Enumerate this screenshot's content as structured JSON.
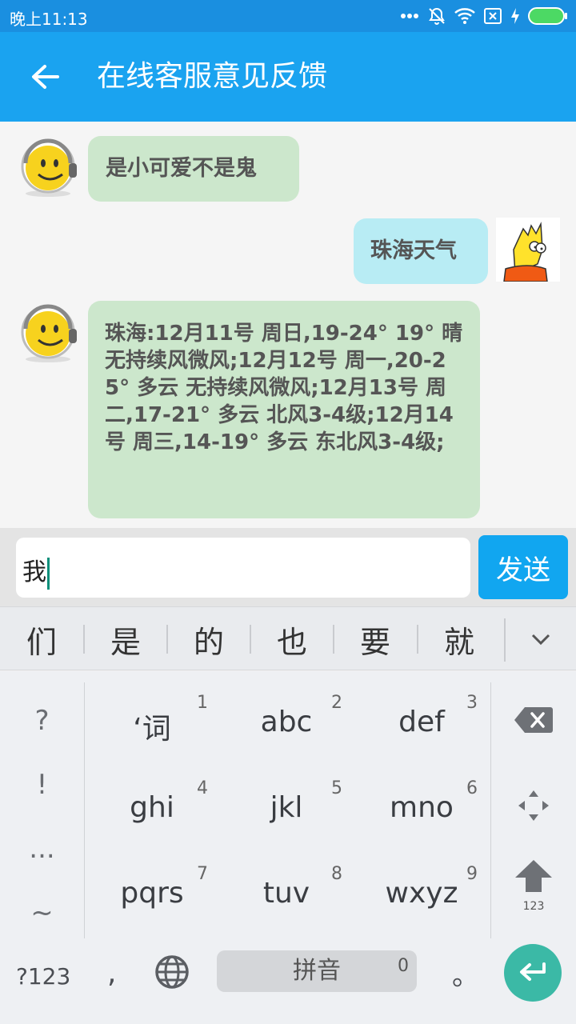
{
  "status_bar": {
    "time": "晚上11:13",
    "icons": [
      "more-dots-icon",
      "mute-bell-icon",
      "wifi-icon",
      "sim-x-icon",
      "charging-bolt-icon",
      "battery-icon"
    ],
    "battery_color": "#4cd964"
  },
  "app_bar": {
    "title": "在线客服意见反馈",
    "color": "#1aa3f0"
  },
  "messages": [
    {
      "side": "left",
      "sender": "bot",
      "text": "是小可爱不是鬼"
    },
    {
      "side": "right",
      "sender": "user",
      "text": "珠海天气"
    },
    {
      "side": "left",
      "sender": "bot",
      "text": "珠海:12月11号 周日,19-24° 19° 晴 无持续风微风;12月12号 周一,20-25° 多云 无持续风微风;12月13号 周二,17-21° 多云 北风3-4级;12月14号 周三,14-19° 多云 东北风3-4级;"
    }
  ],
  "input": {
    "value": "我",
    "send_label": "发送"
  },
  "keyboard": {
    "candidates": [
      "们",
      "是",
      "的",
      "也",
      "要",
      "就"
    ],
    "left_column": [
      "?",
      "!",
      "...",
      "~"
    ],
    "keys": [
      {
        "label": "‘词",
        "num": "1"
      },
      {
        "label": "abc",
        "num": "2"
      },
      {
        "label": "def",
        "num": "3"
      },
      {
        "label": "ghi",
        "num": "4"
      },
      {
        "label": "jkl",
        "num": "5"
      },
      {
        "label": "mno",
        "num": "6"
      },
      {
        "label": "pqrs",
        "num": "7"
      },
      {
        "label": "tuv",
        "num": "8"
      },
      {
        "label": "wxyz",
        "num": "9"
      }
    ],
    "shift_caption": "123",
    "bottom_row": {
      "symbols_label": "?123",
      "comma": ",",
      "space_label": "拼音",
      "space_num": "0",
      "period": "。"
    },
    "enter_color": "#3bb9a6"
  }
}
